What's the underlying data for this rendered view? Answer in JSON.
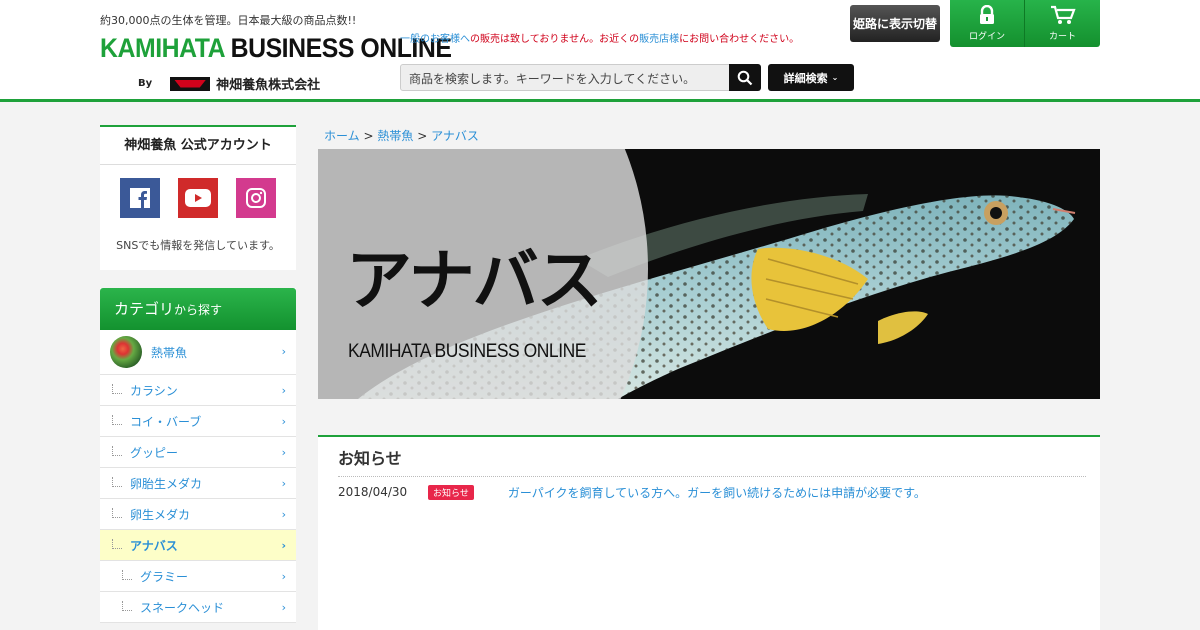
{
  "header": {
    "tagline": "約30,000点の生体を管理。日本最大級の商品点数!!",
    "logo_kamihata": "KAMIHATA",
    "logo_business": " BUSINESS ONLINE",
    "logo_by": "By",
    "company": "神畑養魚株式会社",
    "notice_blue1": "一般のお客様へ",
    "notice_red1": "の販売は致しておりません。お近くの",
    "notice_blue2": "販売店様",
    "notice_red2": "にお問い合わせください。",
    "search_placeholder": "商品を検索します。キーワードを入力してください。",
    "advanced_search": "詳細検索",
    "switch_label": "姫路に表示切替",
    "login_label": "ログイン",
    "cart_label": "カート"
  },
  "sidebar": {
    "sns_title": "神畑養魚 公式アカウント",
    "sns_text": "SNSでも情報を発信しています。",
    "cat_title_main": "カテゴリ",
    "cat_title_sub": "から探す",
    "cat_top": "熱帯魚",
    "items": [
      {
        "label": "カラシン"
      },
      {
        "label": "コイ・バーブ"
      },
      {
        "label": "グッピー"
      },
      {
        "label": "卵胎生メダカ"
      },
      {
        "label": "卵生メダカ"
      },
      {
        "label": "アナバス"
      },
      {
        "label": "グラミー"
      },
      {
        "label": "スネークヘッド"
      }
    ]
  },
  "breadcrumb": {
    "home": "ホーム",
    "sep": ">",
    "level1": "熱帯魚",
    "level2": "アナバス"
  },
  "banner": {
    "title": "アナバス",
    "subtitle": "KAMIHATA BUSINESS ONLINE"
  },
  "news": {
    "title": "お知らせ",
    "items": [
      {
        "date": "2018/04/30",
        "tag": "お知らせ",
        "text": "ガーパイクを飼育している方へ。ガーを飼い続けるためには申請が必要です。"
      }
    ]
  },
  "colors": {
    "brand_green": "#1ea13a",
    "link_blue": "#2a8fd6",
    "notice_red": "#d0021b",
    "tag_red": "#e8264a"
  }
}
